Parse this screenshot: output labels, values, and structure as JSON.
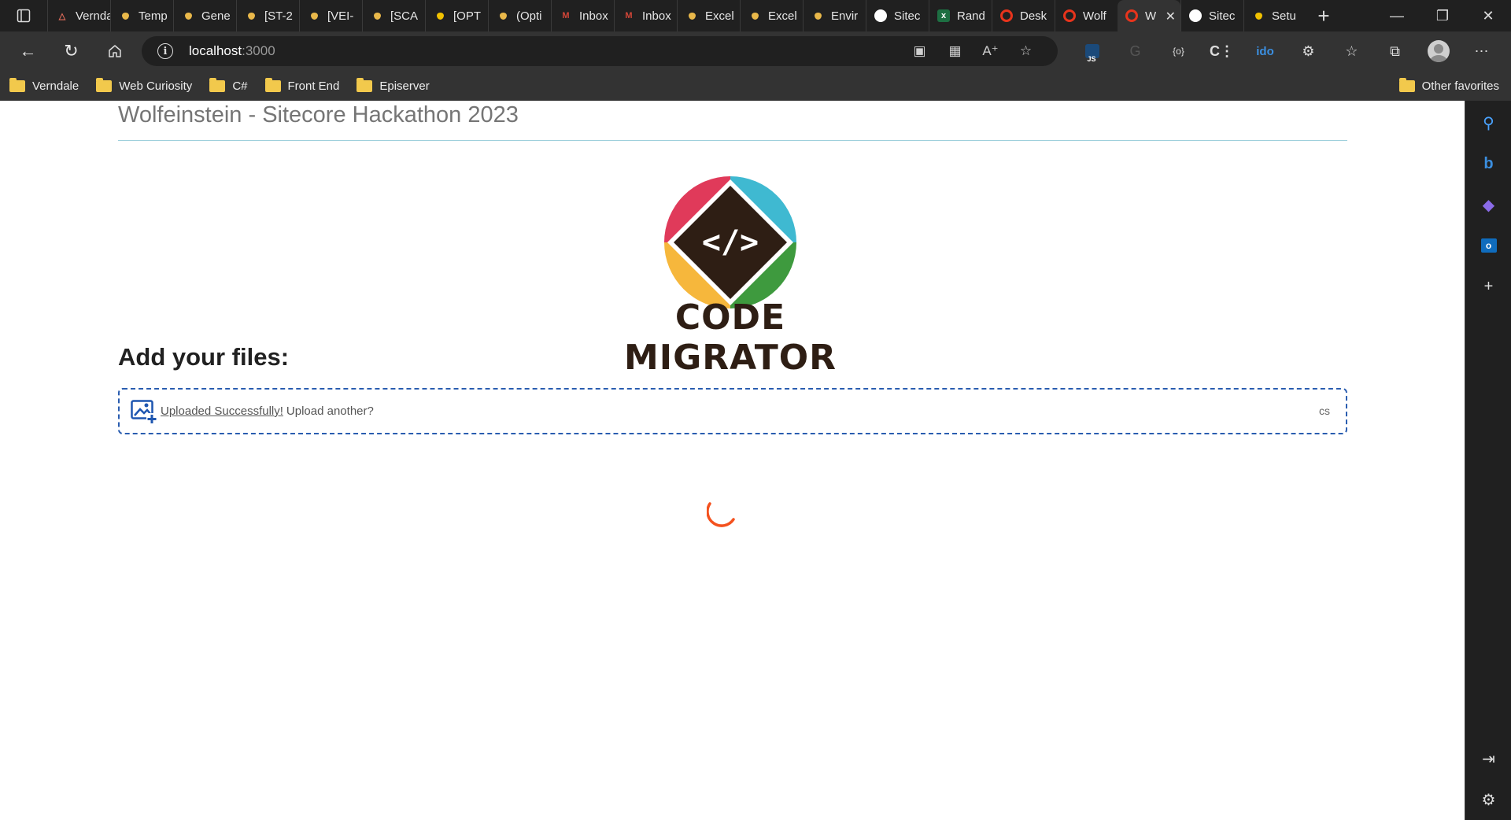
{
  "browser": {
    "tabs": [
      {
        "label": "Verndale",
        "icon": "verndale-icon",
        "color": "#e06c5a"
      },
      {
        "label": "Temp",
        "icon": "site-icon",
        "color": "#e9b84a"
      },
      {
        "label": "Gene",
        "icon": "site-icon",
        "color": "#e9b84a"
      },
      {
        "label": "[ST-2",
        "icon": "site-icon",
        "color": "#e9b84a"
      },
      {
        "label": "[VEI-",
        "icon": "site-icon",
        "color": "#e9b84a"
      },
      {
        "label": "[SCA",
        "icon": "site-icon",
        "color": "#e9b84a"
      },
      {
        "label": "[OPT",
        "icon": "site-icon",
        "color": "#f2c200"
      },
      {
        "label": "(Opti",
        "icon": "site-icon",
        "color": "#e9b84a"
      },
      {
        "label": "Inbox",
        "icon": "gmail-icon",
        "color": "#d44638"
      },
      {
        "label": "Inbox",
        "icon": "gmail-icon",
        "color": "#d44638"
      },
      {
        "label": "Excel",
        "icon": "site-icon",
        "color": "#e9b84a"
      },
      {
        "label": "Excel",
        "icon": "site-icon",
        "color": "#e9b84a"
      },
      {
        "label": "Envir",
        "icon": "site-icon",
        "color": "#e9b84a"
      },
      {
        "label": "Sitec",
        "icon": "github-icon",
        "color": "#ffffff"
      },
      {
        "label": "Rand",
        "icon": "excel-icon",
        "color": "#1d6f42"
      },
      {
        "label": "Desk",
        "icon": "opera-icon",
        "color": "#e8341c"
      },
      {
        "label": "Wolf",
        "icon": "opera-icon",
        "color": "#e8341c"
      },
      {
        "label": "W",
        "icon": "opera-icon",
        "color": "#e8341c",
        "active": true
      },
      {
        "label": "Sitec",
        "icon": "github-icon",
        "color": "#ffffff"
      },
      {
        "label": "Setu",
        "icon": "site-icon",
        "color": "#f2c200"
      }
    ],
    "url_host": "localhost",
    "url_port": ":3000",
    "bookmarks": [
      "Verndale",
      "Web Curiosity",
      "C#",
      "Front End",
      "Episerver"
    ],
    "other_favorites": "Other favorites",
    "extension_badge": "JS"
  },
  "page": {
    "title": "Wolfeinstein - Sitecore Hackathon 2023",
    "logo_text": "CODE MIGRATOR",
    "logo_glyph": "</>",
    "heading": "Add your files:",
    "dropzone": {
      "link": "Uploaded Successfully!",
      "text": "Upload another?",
      "types": "cs"
    }
  },
  "colors": {
    "accent": "#2a5db0",
    "spinner": "#f4511e",
    "logo_red": "#e03a5a",
    "logo_teal": "#3fb9d1",
    "logo_yellow": "#f6b73c",
    "logo_green": "#3e9a3e",
    "logo_dark": "#2e1e14"
  }
}
